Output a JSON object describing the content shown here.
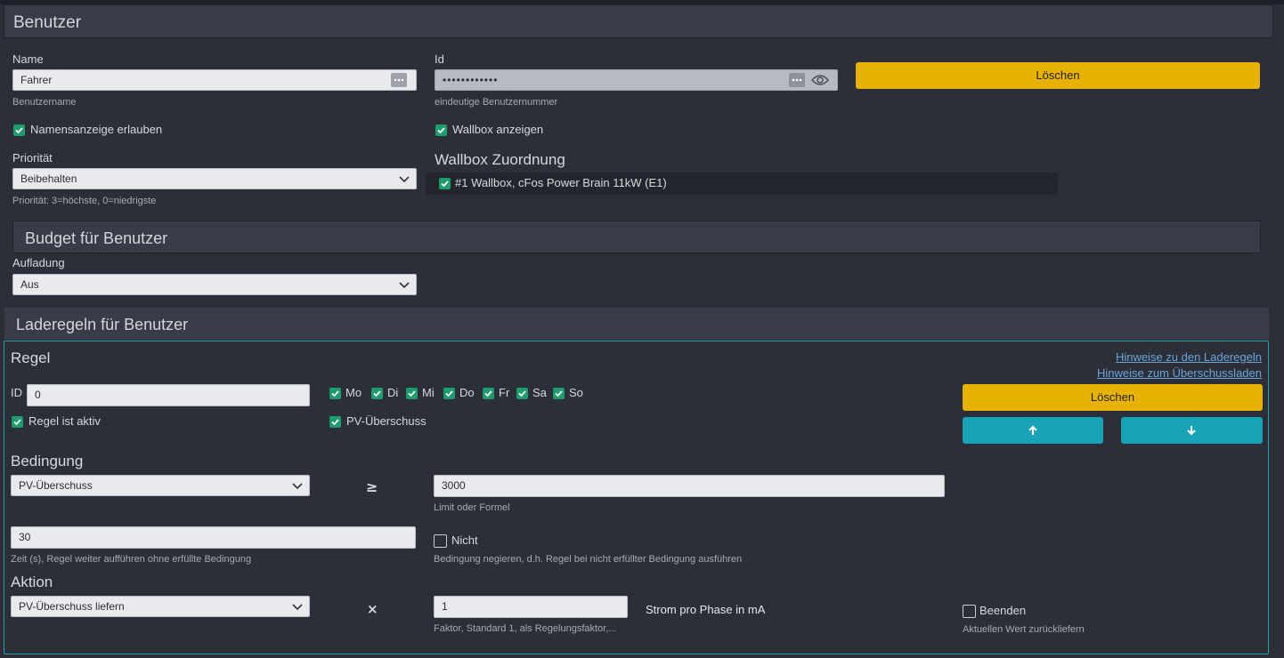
{
  "user": {
    "header": "Benutzer",
    "name_label": "Name",
    "name_value": "Fahrer",
    "name_hint": "Benutzername",
    "id_label": "Id",
    "id_value": "••••••••••••",
    "id_hint": "eindeutige Benutzernummer",
    "delete_label": "Löschen",
    "show_name_label": "Namensanzeige erlauben",
    "show_wallbox_label": "Wallbox anzeigen",
    "priority_label": "Priorität",
    "priority_value": "Beibehalten",
    "priority_hint": "Priorität: 3=höchste, 0=niedrigste",
    "wallbox_assign_title": "Wallbox Zuordnung",
    "wallbox_item": "#1 Wallbox, cFos Power Brain 11kW (E1)"
  },
  "budget": {
    "header": "Budget für Benutzer",
    "charging_label": "Aufladung",
    "charging_value": "Aus"
  },
  "rules": {
    "header": "Laderegeln für Benutzer",
    "rule_title": "Regel",
    "link_rules": "Hinweise zu den Laderegeln",
    "link_surplus": "Hinweise zum Überschussladen",
    "id_label": "ID",
    "id_value": "0",
    "days": [
      "Mo",
      "Di",
      "Mi",
      "Do",
      "Fr",
      "Sa",
      "So"
    ],
    "delete_label": "Löschen",
    "active_label": "Regel ist aktiv",
    "pv_surplus_label": "PV-Überschuss",
    "condition_title": "Bedingung",
    "condition_value": "PV-Überschuss",
    "operator": "≥",
    "limit_value": "3000",
    "limit_hint": "Limit oder Formel",
    "time_value": "30",
    "time_hint": "Zeit (s), Regel weiter aufführen ohne erfüllte Bedingung",
    "not_label": "Nicht",
    "not_hint": "Bedingung negieren, d.h. Regel bei nicht erfüllter Bedingung ausführen",
    "action_title": "Aktion",
    "action_value": "PV-Überschuss liefern",
    "multiply": "×",
    "factor_value": "1",
    "factor_hint": "Faktor, Standard 1, als Regelungsfaktor,...",
    "unit_label": "Strom pro Phase in mA",
    "end_label": "Beenden",
    "end_hint": "Aktuellen Wert zurückliefern"
  },
  "colors": {
    "accent_yellow": "#e8b204",
    "accent_teal": "#17a3b5",
    "checkbox_green": "#1e9c6e",
    "link": "#6aa6d8"
  }
}
